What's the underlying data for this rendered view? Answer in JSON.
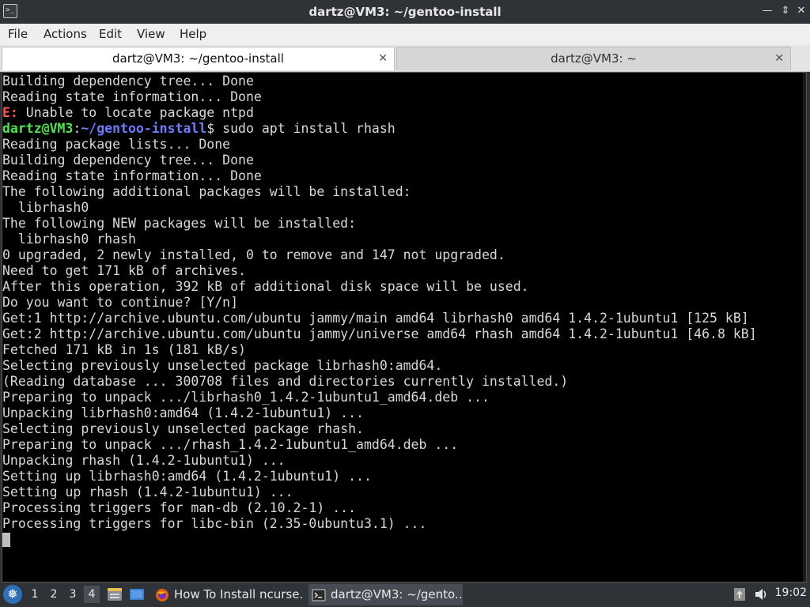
{
  "window": {
    "title": "dartz@VM3: ~/gentoo-install",
    "icon": "terminal-icon",
    "controls": [
      "minimize-icon",
      "maximize-icon",
      "close-icon"
    ]
  },
  "menu": {
    "file": "File",
    "actions": "Actions",
    "edit": "Edit",
    "view": "View",
    "help": "Help"
  },
  "tabs": [
    {
      "label": "dartz@VM3: ~/gentoo-install",
      "active": true
    },
    {
      "label": "dartz@VM3: ~",
      "active": false
    }
  ],
  "terminal": {
    "colors": {
      "background": "#000000",
      "text": "#d8d8d8",
      "error": "#ff5555",
      "user": "#4ee44e",
      "path": "#6d7cff"
    },
    "lines": [
      {
        "text": "Building dependency tree... Done"
      },
      {
        "text": "Reading state information... Done"
      },
      {
        "prefix": "E:",
        "text": " Unable to locate package ntpd"
      },
      {
        "user": "dartz@VM3",
        "sep": ":",
        "path": "~/gentoo-install",
        "text": "$ sudo apt install rhash"
      },
      {
        "text": "Reading package lists... Done"
      },
      {
        "text": "Building dependency tree... Done"
      },
      {
        "text": "Reading state information... Done"
      },
      {
        "text": "The following additional packages will be installed:"
      },
      {
        "text": "  librhash0"
      },
      {
        "text": "The following NEW packages will be installed:"
      },
      {
        "text": "  librhash0 rhash"
      },
      {
        "text": "0 upgraded, 2 newly installed, 0 to remove and 147 not upgraded."
      },
      {
        "text": "Need to get 171 kB of archives."
      },
      {
        "text": "After this operation, 392 kB of additional disk space will be used."
      },
      {
        "text": "Do you want to continue? [Y/n]"
      },
      {
        "text": "Get:1 http://archive.ubuntu.com/ubuntu jammy/main amd64 librhash0 amd64 1.4.2-1ubuntu1 [125 kB]"
      },
      {
        "text": "Get:2 http://archive.ubuntu.com/ubuntu jammy/universe amd64 rhash amd64 1.4.2-1ubuntu1 [46.8 kB]"
      },
      {
        "text": "Fetched 171 kB in 1s (181 kB/s)"
      },
      {
        "text": "Selecting previously unselected package librhash0:amd64."
      },
      {
        "text": "(Reading database ... 300708 files and directories currently installed.)"
      },
      {
        "text": "Preparing to unpack .../librhash0_1.4.2-1ubuntu1_amd64.deb ..."
      },
      {
        "text": "Unpacking librhash0:amd64 (1.4.2-1ubuntu1) ..."
      },
      {
        "text": "Selecting previously unselected package rhash."
      },
      {
        "text": "Preparing to unpack .../rhash_1.4.2-1ubuntu1_amd64.deb ..."
      },
      {
        "text": "Unpacking rhash (1.4.2-1ubuntu1) ..."
      },
      {
        "text": "Setting up librhash0:amd64 (1.4.2-1ubuntu1) ..."
      },
      {
        "text": "Setting up rhash (1.4.2-1ubuntu1) ..."
      },
      {
        "text": "Processing triggers for man-db (2.10.2-1) ..."
      },
      {
        "text": "Processing triggers for libc-bin (2.35-0ubuntu3.1) ..."
      }
    ]
  },
  "taskbar": {
    "start_icon": "lubuntu-start-icon",
    "workspaces": [
      {
        "label": "1",
        "active": false
      },
      {
        "label": "2",
        "active": false
      },
      {
        "label": "3",
        "active": false
      },
      {
        "label": "4",
        "active": true
      }
    ],
    "quick_launch": [
      "file-manager-icon",
      "desktop-icon"
    ],
    "tasks": [
      {
        "icon": "firefox-icon",
        "label": "How To Install ncurse...",
        "active": false
      },
      {
        "icon": "terminal-icon",
        "label": "dartz@VM3: ~/gento...",
        "active": true
      }
    ],
    "tray": [
      "update-notifier-icon",
      "volume-icon"
    ],
    "clock": "19:02"
  }
}
